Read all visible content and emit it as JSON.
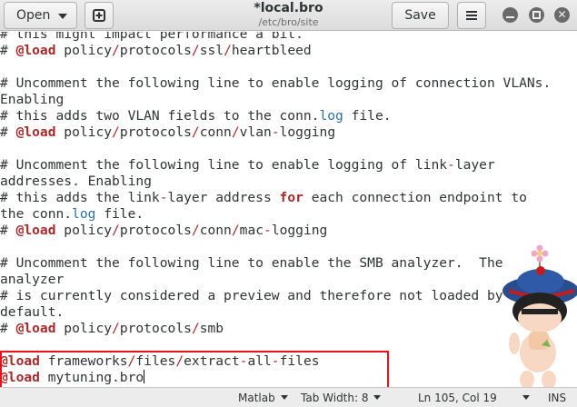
{
  "header": {
    "open_label": "Open",
    "save_label": "Save",
    "title": "*local.bro",
    "subtitle": "/etc/bro/site"
  },
  "editor": {
    "lines": [
      [
        {
          "t": "# this might impact performance a bit.",
          "c": "cmt"
        }
      ],
      [
        {
          "t": "# ",
          "c": "cmt"
        },
        {
          "t": "@load",
          "c": "kw"
        },
        {
          "t": " policy",
          "c": ""
        },
        {
          "t": "/",
          "c": "op"
        },
        {
          "t": "protocols",
          "c": ""
        },
        {
          "t": "/",
          "c": "op"
        },
        {
          "t": "ssl",
          "c": ""
        },
        {
          "t": "/",
          "c": "op"
        },
        {
          "t": "heartbleed",
          "c": ""
        }
      ],
      [
        {
          "t": "",
          "c": ""
        }
      ],
      [
        {
          "t": "# Uncomment the following line to enable logging of connection VLANs.",
          "c": "cmt"
        }
      ],
      [
        {
          "t": "Enabling",
          "c": "cmt"
        }
      ],
      [
        {
          "t": "# this adds two VLAN fields to the conn.",
          "c": "cmt"
        },
        {
          "t": "log",
          "c": "fn"
        },
        {
          "t": " file.",
          "c": "cmt"
        }
      ],
      [
        {
          "t": "# ",
          "c": "cmt"
        },
        {
          "t": "@load",
          "c": "kw"
        },
        {
          "t": " policy",
          "c": ""
        },
        {
          "t": "/",
          "c": "op"
        },
        {
          "t": "protocols",
          "c": ""
        },
        {
          "t": "/",
          "c": "op"
        },
        {
          "t": "conn",
          "c": ""
        },
        {
          "t": "/",
          "c": "op"
        },
        {
          "t": "vlan",
          "c": ""
        },
        {
          "t": "-",
          "c": "op"
        },
        {
          "t": "logging",
          "c": ""
        }
      ],
      [
        {
          "t": "",
          "c": ""
        }
      ],
      [
        {
          "t": "# Uncomment the following line to enable logging of link",
          "c": "cmt"
        },
        {
          "t": "-",
          "c": "op"
        },
        {
          "t": "layer",
          "c": "cmt"
        }
      ],
      [
        {
          "t": "addresses. Enabling",
          "c": "cmt"
        }
      ],
      [
        {
          "t": "# this adds the link",
          "c": "cmt"
        },
        {
          "t": "-",
          "c": "op"
        },
        {
          "t": "layer address ",
          "c": "cmt"
        },
        {
          "t": "for",
          "c": "kw2"
        },
        {
          "t": " each connection endpoint to",
          "c": "cmt"
        }
      ],
      [
        {
          "t": "the conn.",
          "c": "cmt"
        },
        {
          "t": "log",
          "c": "fn"
        },
        {
          "t": " file.",
          "c": "cmt"
        }
      ],
      [
        {
          "t": "# ",
          "c": "cmt"
        },
        {
          "t": "@load",
          "c": "kw"
        },
        {
          "t": " policy",
          "c": ""
        },
        {
          "t": "/",
          "c": "op"
        },
        {
          "t": "protocols",
          "c": ""
        },
        {
          "t": "/",
          "c": "op"
        },
        {
          "t": "conn",
          "c": ""
        },
        {
          "t": "/",
          "c": "op"
        },
        {
          "t": "mac",
          "c": ""
        },
        {
          "t": "-",
          "c": "op"
        },
        {
          "t": "logging",
          "c": ""
        }
      ],
      [
        {
          "t": "",
          "c": ""
        }
      ],
      [
        {
          "t": "# Uncomment the following line to enable the SMB analyzer.  The",
          "c": "cmt"
        }
      ],
      [
        {
          "t": "analyzer",
          "c": "cmt"
        }
      ],
      [
        {
          "t": "# is currently considered a preview and therefore not loaded by",
          "c": "cmt"
        }
      ],
      [
        {
          "t": "default.",
          "c": "cmt"
        }
      ],
      [
        {
          "t": "# ",
          "c": "cmt"
        },
        {
          "t": "@load",
          "c": "kw"
        },
        {
          "t": " policy",
          "c": ""
        },
        {
          "t": "/",
          "c": "op"
        },
        {
          "t": "protocols",
          "c": ""
        },
        {
          "t": "/",
          "c": "op"
        },
        {
          "t": "smb",
          "c": ""
        }
      ],
      [
        {
          "t": "",
          "c": ""
        }
      ],
      [
        {
          "t": "@load",
          "c": "kw"
        },
        {
          "t": " frameworks",
          "c": ""
        },
        {
          "t": "/",
          "c": "op"
        },
        {
          "t": "files",
          "c": ""
        },
        {
          "t": "/",
          "c": "op"
        },
        {
          "t": "extract",
          "c": ""
        },
        {
          "t": "-",
          "c": "op"
        },
        {
          "t": "all",
          "c": ""
        },
        {
          "t": "-",
          "c": "op"
        },
        {
          "t": "files",
          "c": ""
        }
      ],
      [
        {
          "t": "@load",
          "c": "kw"
        },
        {
          "t": " mytuning.bro",
          "c": ""
        }
      ]
    ]
  },
  "status": {
    "language": "Matlab",
    "tab_width": "Tab Width: 8",
    "position": "Ln 105, Col 19",
    "mode": "INS"
  },
  "icons": {
    "new_document": "new-document-icon",
    "hamburger": "hamburger-menu-icon",
    "minimize": "minimize-icon",
    "maximize": "maximize-icon",
    "close": "close-icon",
    "mascot": "mascot-sticker"
  },
  "colors": {
    "highlight_box": "#e8121b",
    "keyword": "#a52a2a",
    "accent_blue": "#2b6fa8"
  }
}
